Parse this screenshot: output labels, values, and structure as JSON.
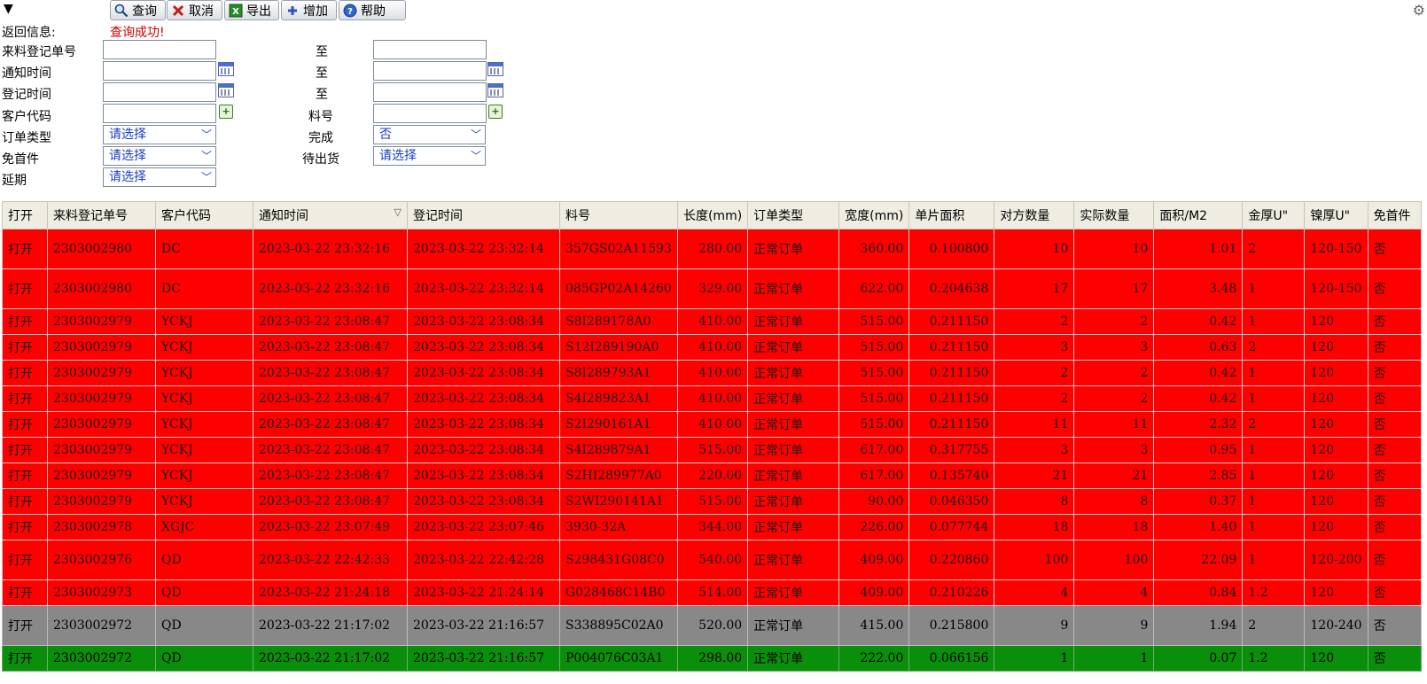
{
  "toolbar": {
    "collapse_glyph": "▼",
    "buttons": [
      {
        "label": "查询",
        "icon": "search-icon"
      },
      {
        "label": "取消",
        "icon": "cancel-icon"
      },
      {
        "label": "导出",
        "icon": "excel-export-icon"
      },
      {
        "label": "增加",
        "icon": "add-icon"
      },
      {
        "label": "帮助",
        "icon": "help-icon"
      }
    ]
  },
  "form": {
    "return_info_label": "返回信息:",
    "return_info_value": "查询成功!",
    "receipt_no_label": "来料登记单号",
    "to_label": "至",
    "notify_time_label": "通知时间",
    "register_time_label": "登记时间",
    "customer_code_label": "客户代码",
    "part_no_label": "料号",
    "order_type_label": "订单类型",
    "order_type_value": "请选择",
    "completed_label": "完成",
    "completed_value": "否",
    "first_article_label": "免首件",
    "first_article_value": "请选择",
    "pending_ship_label": "待出货",
    "pending_ship_value": "请选择",
    "delay_label": "延期",
    "delay_value": "请选择"
  },
  "table": {
    "columns": [
      "打开",
      "来料登记单号",
      "客户代码",
      "通知时间",
      "登记时间",
      "料号",
      "长度(mm)",
      "订单类型",
      "宽度(mm)",
      "单片面积",
      "对方数量",
      "实际数量",
      "面积/M2",
      "金厚U\"",
      "镍厚U\"",
      "免首件"
    ],
    "rows": [
      {
        "status": "red",
        "cells": [
          "打开",
          "2303002980",
          "DC",
          "2023-03-22 23:32:16",
          "2023-03-22 23:32:14",
          "357GS02A11593",
          "280.00",
          "正常订单",
          "360.00",
          "0.100800",
          "10",
          "10",
          "1.01",
          "2",
          "120-150",
          "否"
        ]
      },
      {
        "status": "red",
        "cells": [
          "打开",
          "2303002980",
          "DC",
          "2023-03-22 23:32:16",
          "2023-03-22 23:32:14",
          "085GP02A14260",
          "329.00",
          "正常订单",
          "622.00",
          "0.204638",
          "17",
          "17",
          "3.48",
          "1",
          "120-150",
          "否"
        ]
      },
      {
        "status": "red",
        "cells": [
          "打开",
          "2303002979",
          "YCKJ",
          "2023-03-22 23:08:47",
          "2023-03-22 23:08:34",
          "S8I289178A0",
          "410.00",
          "正常订单",
          "515.00",
          "0.211150",
          "2",
          "2",
          "0.42",
          "1",
          "120",
          "否"
        ]
      },
      {
        "status": "red",
        "cells": [
          "打开",
          "2303002979",
          "YCKJ",
          "2023-03-22 23:08:47",
          "2023-03-22 23:08:34",
          "S12I289190A0",
          "410.00",
          "正常订单",
          "515.00",
          "0.211150",
          "3",
          "3",
          "0.63",
          "2",
          "120",
          "否"
        ]
      },
      {
        "status": "red",
        "cells": [
          "打开",
          "2303002979",
          "YCKJ",
          "2023-03-22 23:08:47",
          "2023-03-22 23:08:34",
          "S8I289793A1",
          "410.00",
          "正常订单",
          "515.00",
          "0.211150",
          "2",
          "2",
          "0.42",
          "1",
          "120",
          "否"
        ]
      },
      {
        "status": "red",
        "cells": [
          "打开",
          "2303002979",
          "YCKJ",
          "2023-03-22 23:08:47",
          "2023-03-22 23:08:34",
          "S4I289823A1",
          "410.00",
          "正常订单",
          "515.00",
          "0.211150",
          "2",
          "2",
          "0.42",
          "1",
          "120",
          "否"
        ]
      },
      {
        "status": "red",
        "cells": [
          "打开",
          "2303002979",
          "YCKJ",
          "2023-03-22 23:08:47",
          "2023-03-22 23:08:34",
          "S2I290161A1",
          "410.00",
          "正常订单",
          "515.00",
          "0.211150",
          "11",
          "11",
          "2.32",
          "2",
          "120",
          "否"
        ]
      },
      {
        "status": "red",
        "cells": [
          "打开",
          "2303002979",
          "YCKJ",
          "2023-03-22 23:08:47",
          "2023-03-22 23:08:34",
          "S4I289879A1",
          "515.00",
          "正常订单",
          "617.00",
          "0.317755",
          "3",
          "3",
          "0.95",
          "1",
          "120",
          "否"
        ]
      },
      {
        "status": "red",
        "cells": [
          "打开",
          "2303002979",
          "YCKJ",
          "2023-03-22 23:08:47",
          "2023-03-22 23:08:34",
          "S2HI289977A0",
          "220.00",
          "正常订单",
          "617.00",
          "0.135740",
          "21",
          "21",
          "2.85",
          "1",
          "120",
          "否"
        ]
      },
      {
        "status": "red",
        "cells": [
          "打开",
          "2303002979",
          "YCKJ",
          "2023-03-22 23:08:47",
          "2023-03-22 23:08:34",
          "S2WI290141A1",
          "515.00",
          "正常订单",
          "90.00",
          "0.046350",
          "8",
          "8",
          "0.37",
          "1",
          "120",
          "否"
        ]
      },
      {
        "status": "red",
        "cells": [
          "打开",
          "2303002978",
          "XGJC",
          "2023-03-22 23:07:49",
          "2023-03-22 23:07:46",
          "3930-32A",
          "344.00",
          "正常订单",
          "226.00",
          "0.077744",
          "18",
          "18",
          "1.40",
          "1",
          "120",
          "否"
        ]
      },
      {
        "status": "red",
        "cells": [
          "打开",
          "2303002976",
          "QD",
          "2023-03-22 22:42:33",
          "2023-03-22 22:42:28",
          "S298431G08C0",
          "540.00",
          "正常订单",
          "409.00",
          "0.220860",
          "100",
          "100",
          "22.09",
          "1",
          "120-200",
          "否"
        ]
      },
      {
        "status": "red",
        "cells": [
          "打开",
          "2303002973",
          "QD",
          "2023-03-22 21:24:18",
          "2023-03-22 21:24:14",
          "G028468C14B0",
          "514.00",
          "正常订单",
          "409.00",
          "0.210226",
          "4",
          "4",
          "0.84",
          "1.2",
          "120",
          "否"
        ]
      },
      {
        "status": "gray",
        "cells": [
          "打开",
          "2303002972",
          "QD",
          "2023-03-22 21:17:02",
          "2023-03-22 21:16:57",
          "S338895C02A0",
          "520.00",
          "正常订单",
          "415.00",
          "0.215800",
          "9",
          "9",
          "1.94",
          "2",
          "120-240",
          "否"
        ]
      },
      {
        "status": "green",
        "cells": [
          "打开",
          "2303002972",
          "QD",
          "2023-03-22 21:17:02",
          "2023-03-22 21:16:57",
          "P004076C03A1",
          "298.00",
          "正常订单",
          "222.00",
          "0.066156",
          "1",
          "1",
          "0.07",
          "1.2",
          "120",
          "否"
        ]
      }
    ]
  }
}
